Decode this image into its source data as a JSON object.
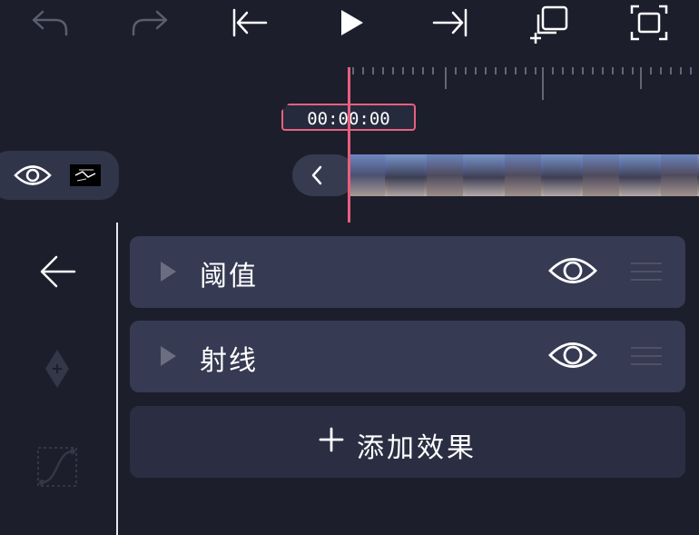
{
  "toolbar": {
    "items": [
      {
        "name": "undo",
        "icon": "undo-icon",
        "enabled": false
      },
      {
        "name": "redo",
        "icon": "redo-icon",
        "enabled": false
      },
      {
        "name": "skip-to-start",
        "icon": "skip-to-start-icon",
        "enabled": true
      },
      {
        "name": "play",
        "icon": "play-icon",
        "enabled": true
      },
      {
        "name": "skip-to-end",
        "icon": "skip-to-end-icon",
        "enabled": true
      },
      {
        "name": "add-copy",
        "icon": "copy-add-icon",
        "enabled": true
      },
      {
        "name": "fullscreen",
        "icon": "fullscreen-icon",
        "enabled": true
      }
    ]
  },
  "timeline": {
    "timecode": "00:00:00",
    "playhead_color": "#e8607d",
    "track_visibility_icon": "eye-icon",
    "collapse_icon": "chevron-left-icon"
  },
  "sidebar": {
    "items": [
      {
        "name": "back",
        "icon": "arrow-left-icon",
        "enabled": true
      },
      {
        "name": "keyframe",
        "icon": "keyframe-add-icon",
        "enabled": false
      },
      {
        "name": "curve",
        "icon": "curve-icon",
        "enabled": false
      }
    ]
  },
  "effects": [
    {
      "name": "阈值",
      "expand_icon": "triangle-right-icon",
      "visibility_icon": "eye-icon",
      "handle_icon": "drag-handle-icon"
    },
    {
      "name": "射线",
      "expand_icon": "triangle-right-icon",
      "visibility_icon": "eye-icon",
      "handle_icon": "drag-handle-icon"
    }
  ],
  "add_effect": {
    "icon": "plus-icon",
    "label": "添加效果"
  },
  "colors": {
    "background": "#1d1e2c",
    "card": "#363a52",
    "accent": "#e8607d"
  }
}
